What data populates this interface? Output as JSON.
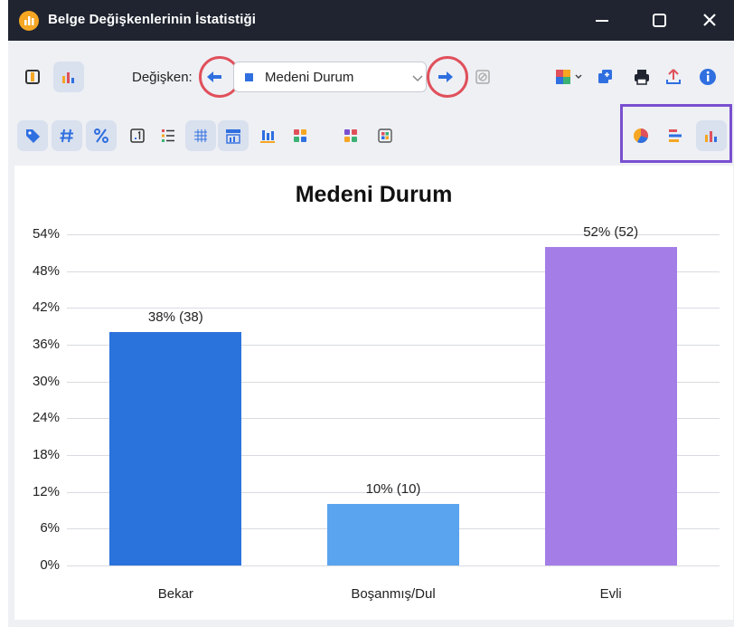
{
  "window": {
    "title": "Belge Değişkenlerinin İstatistiği"
  },
  "toolbar": {
    "variable_label": "Değişken:",
    "variable_value": "Medeni Durum"
  },
  "colors": {
    "accent": "#2f6fe0",
    "highlight_circle": "#e0505b",
    "highlight_box": "#7a4fd0"
  },
  "icons": [
    "app-logo-icon",
    "minimize-icon",
    "maximize-icon",
    "close-icon",
    "frequency-table-icon",
    "bar-chart-icon",
    "arrow-left-icon",
    "arrow-right-icon",
    "clear-icon",
    "palette-icon",
    "copy-icon",
    "print-icon",
    "export-icon",
    "info-icon",
    "tag-icon",
    "hash-icon",
    "percent-icon",
    "decimal-icon",
    "list-icon",
    "grid-icon",
    "value-bar-icon",
    "bar-labels-icon",
    "color-scheme-icon",
    "color-palette-icon",
    "palette-edit-icon",
    "pie-chart-icon",
    "horizontal-bar-icon",
    "vertical-bar-icon"
  ],
  "chart_data": {
    "type": "bar",
    "title": "Medeni Durum",
    "categories": [
      "Bekar",
      "Boşanmış/Dul",
      "Evli"
    ],
    "values": [
      38,
      10,
      52
    ],
    "counts": [
      38,
      10,
      52
    ],
    "data_labels": [
      "38% (38)",
      "10% (10)",
      "52% (52)"
    ],
    "bar_colors": [
      "#2b73dc",
      "#5aa4ef",
      "#a57de6"
    ],
    "ylim": [
      0,
      54
    ],
    "yticks": [
      "0%",
      "6%",
      "12%",
      "18%",
      "24%",
      "30%",
      "36%",
      "42%",
      "48%",
      "54%"
    ],
    "grid": true
  }
}
